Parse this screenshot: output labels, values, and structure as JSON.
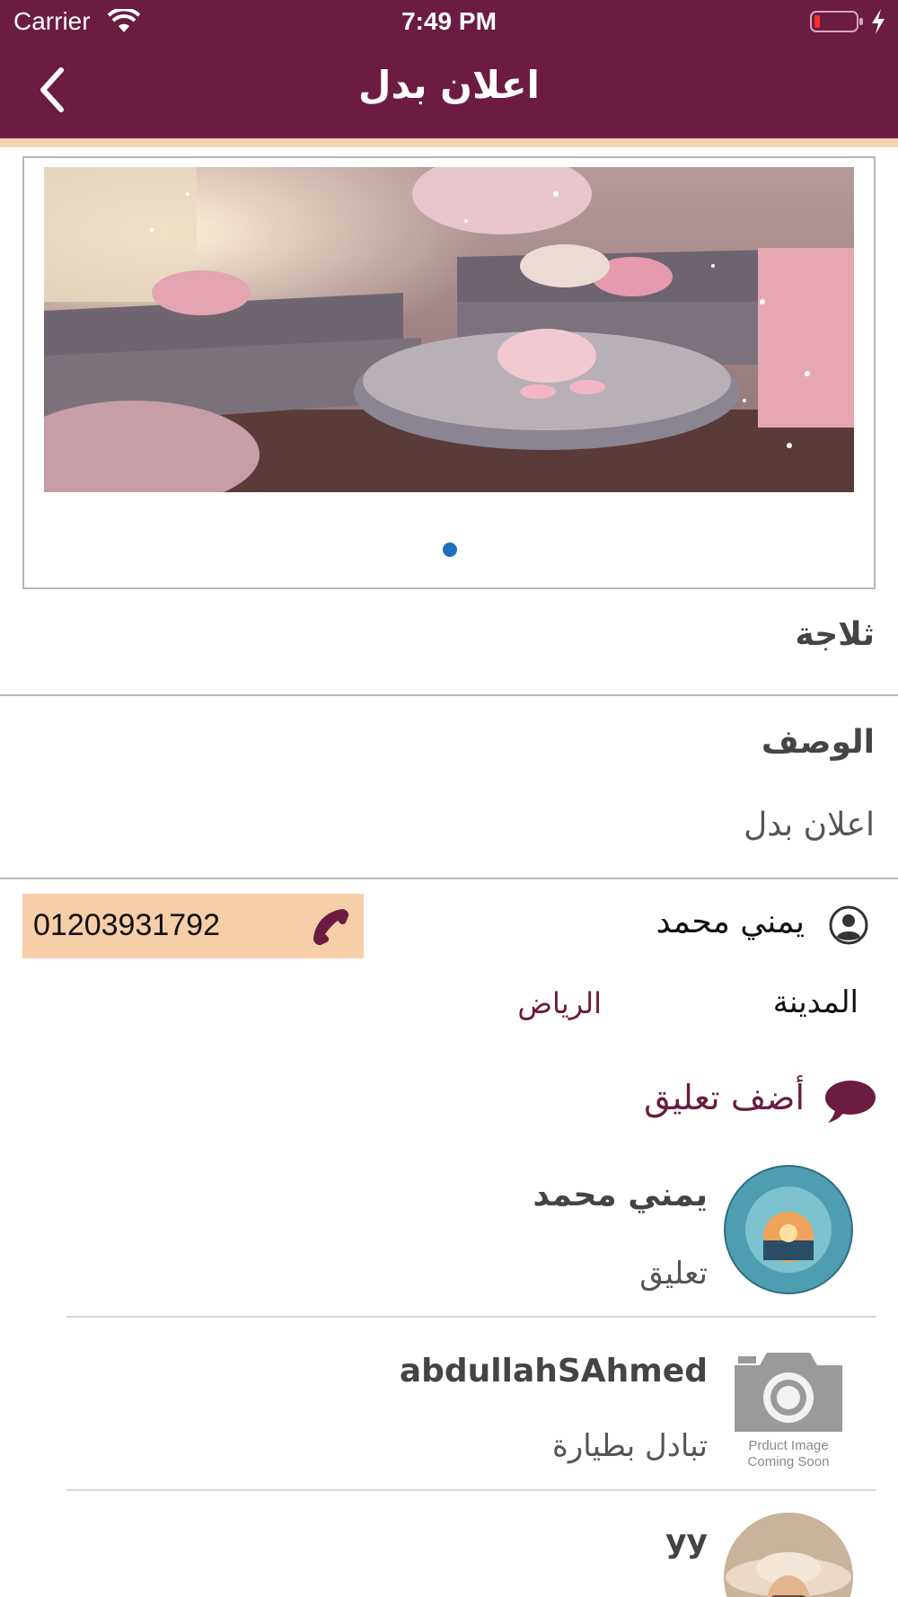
{
  "status_bar": {
    "carrier": "Carrier",
    "time": "7:49 PM"
  },
  "nav": {
    "title": "اعلان بدل"
  },
  "carousel": {
    "image": "living-room-photo",
    "page_count": 1,
    "active_page": 1
  },
  "product": {
    "title": "ثلاجة",
    "description_heading": "الوصف",
    "description": "اعلان بدل"
  },
  "owner": {
    "name": "يمني محمد",
    "phone": "01203931792",
    "city_label": "المدينة",
    "city": "الرياض"
  },
  "comments_section": {
    "add_label": "أضف تعليق"
  },
  "comments": [
    {
      "name": "يمني محمد",
      "text": "تعليق",
      "avatar": "ocean-wave-photo"
    },
    {
      "name": "abdullahSAhmed",
      "text": "تبادل بطيارة",
      "avatar": "camera-placeholder-icon",
      "placeholder_text": [
        "Prduct Image",
        "Coming Soon"
      ]
    },
    {
      "name": "yy",
      "text": "",
      "avatar": "woman-hat-photo"
    }
  ],
  "colors": {
    "primary": "#6b1c40",
    "accent": "#f5d2b0",
    "phone_bg": "#f6cea8",
    "dot": "#1f6fbf"
  }
}
